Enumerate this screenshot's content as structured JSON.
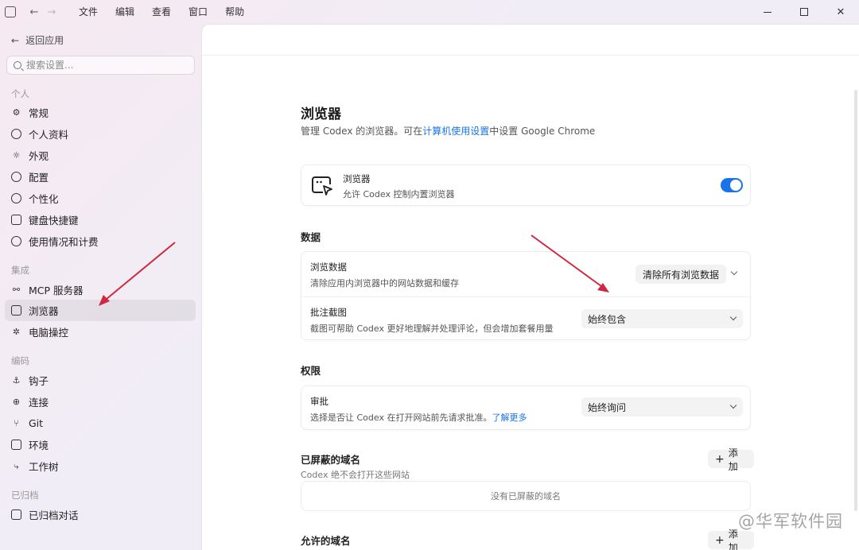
{
  "titlebar": {
    "menu": [
      "文件",
      "编辑",
      "查看",
      "窗口",
      "帮助"
    ]
  },
  "sidebar": {
    "back_label": "返回应用",
    "search_placeholder": "搜索设置...",
    "sections": {
      "personal": "个人",
      "integration": "集成",
      "coding": "编码",
      "archived": "已归档"
    },
    "items": {
      "general": "常规",
      "profile": "个人资料",
      "appearance": "外观",
      "config": "配置",
      "personalize": "个性化",
      "shortcuts": "键盘快捷键",
      "usage": "使用情况和计费",
      "mcp": "MCP 服务器",
      "browser": "浏览器",
      "computer_control": "电脑操控",
      "hooks": "钩子",
      "connections": "连接",
      "git": "Git",
      "env": "环境",
      "worktree": "工作树",
      "archived_chats": "已归档对话"
    }
  },
  "main": {
    "title": "浏览器",
    "subtitle_pre": "管理 Codex 的浏览器。可在",
    "subtitle_link": "计算机使用设置",
    "subtitle_post": "中设置 Google Chrome",
    "browser_card": {
      "title": "浏览器",
      "desc": "允许 Codex 控制内置浏览器",
      "enabled": true
    },
    "data_section": "数据",
    "browse_data": {
      "title": "浏览数据",
      "desc": "清除应用内浏览器中的网站数据和缓存",
      "button": "清除所有浏览数据"
    },
    "annot_screens": {
      "title": "批注截图",
      "desc": "截图可帮助 Codex 更好地理解并处理评论，但会增加套餐用量",
      "value": "始终包含"
    },
    "permissions_section": "权限",
    "approval": {
      "title": "审批",
      "desc": "选择是否让 Codex 在打开网站前先请求批准。",
      "link": "了解更多",
      "value": "始终询问"
    },
    "blocked": {
      "title": "已屏蔽的域名",
      "desc": "Codex 绝不会打开这些网站",
      "add": "添加",
      "empty": "没有已屏蔽的域名"
    },
    "allowed": {
      "title": "允许的域名",
      "add": "添加"
    }
  },
  "watermark": "@华军软件园",
  "colors": {
    "accent": "#1a73e8",
    "arrow": "#d0263f"
  }
}
